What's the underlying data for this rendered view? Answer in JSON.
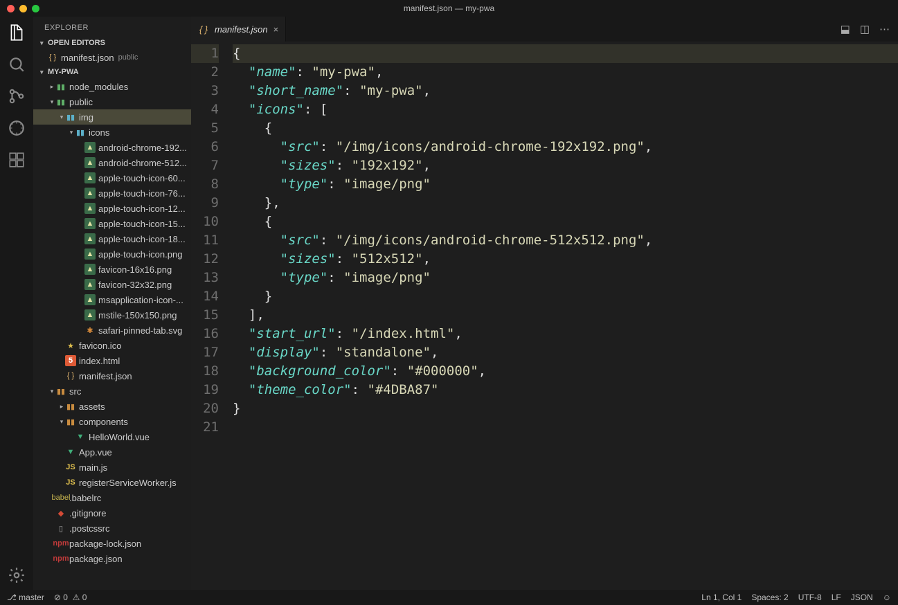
{
  "title": "manifest.json — my-pwa",
  "sidebar": {
    "title": "EXPLORER",
    "sections": {
      "openEditors": "OPEN EDITORS",
      "project": "MY-PWA"
    },
    "openEditor": {
      "name": "manifest.json",
      "desc": "public"
    }
  },
  "tree": [
    {
      "d": 1,
      "tw": "▸",
      "ic": "folder",
      "name": "node_modules"
    },
    {
      "d": 1,
      "tw": "▾",
      "ic": "folder",
      "name": "public"
    },
    {
      "d": 2,
      "tw": "▾",
      "ic": "folder-img",
      "name": "img",
      "sel": true
    },
    {
      "d": 3,
      "tw": "▾",
      "ic": "folder-img",
      "name": "icons"
    },
    {
      "d": 4,
      "tw": "",
      "ic": "img",
      "name": "android-chrome-192..."
    },
    {
      "d": 4,
      "tw": "",
      "ic": "img",
      "name": "android-chrome-512..."
    },
    {
      "d": 4,
      "tw": "",
      "ic": "img",
      "name": "apple-touch-icon-60..."
    },
    {
      "d": 4,
      "tw": "",
      "ic": "img",
      "name": "apple-touch-icon-76..."
    },
    {
      "d": 4,
      "tw": "",
      "ic": "img",
      "name": "apple-touch-icon-12..."
    },
    {
      "d": 4,
      "tw": "",
      "ic": "img",
      "name": "apple-touch-icon-15..."
    },
    {
      "d": 4,
      "tw": "",
      "ic": "img",
      "name": "apple-touch-icon-18..."
    },
    {
      "d": 4,
      "tw": "",
      "ic": "img",
      "name": "apple-touch-icon.png"
    },
    {
      "d": 4,
      "tw": "",
      "ic": "img",
      "name": "favicon-16x16.png"
    },
    {
      "d": 4,
      "tw": "",
      "ic": "img",
      "name": "favicon-32x32.png"
    },
    {
      "d": 4,
      "tw": "",
      "ic": "img",
      "name": "msapplication-icon-..."
    },
    {
      "d": 4,
      "tw": "",
      "ic": "img",
      "name": "mstile-150x150.png"
    },
    {
      "d": 4,
      "tw": "",
      "ic": "bug",
      "name": "safari-pinned-tab.svg"
    },
    {
      "d": 2,
      "tw": "",
      "ic": "fav",
      "name": "favicon.ico"
    },
    {
      "d": 2,
      "tw": "",
      "ic": "html",
      "name": "index.html"
    },
    {
      "d": 2,
      "tw": "",
      "ic": "json",
      "name": "manifest.json"
    },
    {
      "d": 1,
      "tw": "▾",
      "ic": "folder-src",
      "name": "src"
    },
    {
      "d": 2,
      "tw": "▸",
      "ic": "folder-src",
      "name": "assets"
    },
    {
      "d": 2,
      "tw": "▾",
      "ic": "folder-src",
      "name": "components"
    },
    {
      "d": 3,
      "tw": "",
      "ic": "vue",
      "name": "HelloWorld.vue"
    },
    {
      "d": 2,
      "tw": "",
      "ic": "vue",
      "name": "App.vue"
    },
    {
      "d": 2,
      "tw": "",
      "ic": "js",
      "name": "main.js"
    },
    {
      "d": 2,
      "tw": "",
      "ic": "js",
      "name": "registerServiceWorker.js"
    },
    {
      "d": 1,
      "tw": "",
      "ic": "babel",
      "name": ".babelrc"
    },
    {
      "d": 1,
      "tw": "",
      "ic": "git",
      "name": ".gitignore"
    },
    {
      "d": 1,
      "tw": "",
      "ic": "file",
      "name": ".postcssrc"
    },
    {
      "d": 1,
      "tw": "",
      "ic": "npm",
      "name": "package-lock.json"
    },
    {
      "d": 1,
      "tw": "",
      "ic": "npm",
      "name": "package.json"
    }
  ],
  "tab": {
    "name": "manifest.json"
  },
  "code": {
    "lines": [
      [
        [
          "p",
          "{"
        ]
      ],
      [
        [
          "p",
          "  "
        ],
        [
          "k",
          "\"name\""
        ],
        [
          "p",
          ": "
        ],
        [
          "s",
          "\"my-pwa\""
        ],
        [
          "p",
          ","
        ]
      ],
      [
        [
          "p",
          "  "
        ],
        [
          "k",
          "\"short_name\""
        ],
        [
          "p",
          ": "
        ],
        [
          "s",
          "\"my-pwa\""
        ],
        [
          "p",
          ","
        ]
      ],
      [
        [
          "p",
          "  "
        ],
        [
          "k",
          "\"icons\""
        ],
        [
          "p",
          ": ["
        ]
      ],
      [
        [
          "p",
          "    {"
        ]
      ],
      [
        [
          "p",
          "      "
        ],
        [
          "k",
          "\"src\""
        ],
        [
          "p",
          ": "
        ],
        [
          "s",
          "\"/img/icons/android-chrome-192x192.png\""
        ],
        [
          "p",
          ","
        ]
      ],
      [
        [
          "p",
          "      "
        ],
        [
          "k",
          "\"sizes\""
        ],
        [
          "p",
          ": "
        ],
        [
          "s",
          "\"192x192\""
        ],
        [
          "p",
          ","
        ]
      ],
      [
        [
          "p",
          "      "
        ],
        [
          "k",
          "\"type\""
        ],
        [
          "p",
          ": "
        ],
        [
          "s",
          "\"image/png\""
        ]
      ],
      [
        [
          "p",
          "    },"
        ]
      ],
      [
        [
          "p",
          "    {"
        ]
      ],
      [
        [
          "p",
          "      "
        ],
        [
          "k",
          "\"src\""
        ],
        [
          "p",
          ": "
        ],
        [
          "s",
          "\"/img/icons/android-chrome-512x512.png\""
        ],
        [
          "p",
          ","
        ]
      ],
      [
        [
          "p",
          "      "
        ],
        [
          "k",
          "\"sizes\""
        ],
        [
          "p",
          ": "
        ],
        [
          "s",
          "\"512x512\""
        ],
        [
          "p",
          ","
        ]
      ],
      [
        [
          "p",
          "      "
        ],
        [
          "k",
          "\"type\""
        ],
        [
          "p",
          ": "
        ],
        [
          "s",
          "\"image/png\""
        ]
      ],
      [
        [
          "p",
          "    }"
        ]
      ],
      [
        [
          "p",
          "  ],"
        ]
      ],
      [
        [
          "p",
          "  "
        ],
        [
          "k",
          "\"start_url\""
        ],
        [
          "p",
          ": "
        ],
        [
          "s",
          "\"/index.html\""
        ],
        [
          "p",
          ","
        ]
      ],
      [
        [
          "p",
          "  "
        ],
        [
          "k",
          "\"display\""
        ],
        [
          "p",
          ": "
        ],
        [
          "s",
          "\"standalone\""
        ],
        [
          "p",
          ","
        ]
      ],
      [
        [
          "p",
          "  "
        ],
        [
          "k",
          "\"background_color\""
        ],
        [
          "p",
          ": "
        ],
        [
          "s",
          "\"#000000\""
        ],
        [
          "p",
          ","
        ]
      ],
      [
        [
          "p",
          "  "
        ],
        [
          "k",
          "\"theme_color\""
        ],
        [
          "p",
          ": "
        ],
        [
          "s",
          "\"#4DBA87\""
        ]
      ],
      [
        [
          "p",
          "}"
        ]
      ],
      [
        [
          "p",
          ""
        ]
      ]
    ]
  },
  "status": {
    "branch": "master",
    "errors": "0",
    "warnings": "0",
    "pos": "Ln 1, Col 1",
    "spaces": "Spaces: 2",
    "encoding": "UTF-8",
    "eol": "LF",
    "lang": "JSON"
  }
}
